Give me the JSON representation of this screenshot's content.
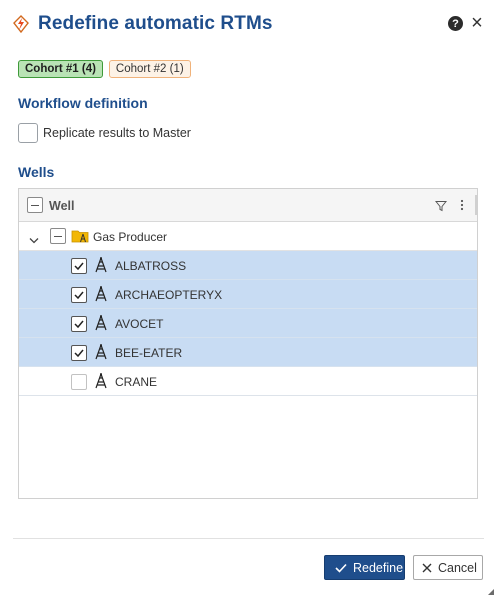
{
  "dialog": {
    "title": "Redefine automatic RTMs",
    "help_icon": "question-circle-icon",
    "close_icon": "close-icon",
    "help_glyph": "?",
    "close_glyph": "×"
  },
  "cohorts": [
    {
      "label": "Cohort #1 (4)",
      "active": true,
      "color": "#3f9a3a"
    },
    {
      "label": "Cohort #2 (1)",
      "active": false,
      "color": "#f0b27a"
    }
  ],
  "workflow": {
    "section_title": "Workflow definition",
    "replicate_label": "Replicate results to Master",
    "replicate_checked": false
  },
  "wells": {
    "section_title": "Wells",
    "column_header": "Well",
    "group": {
      "label": "Gas Producer",
      "expanded": true,
      "state": "indeterminate"
    },
    "items": [
      {
        "name": "ALBATROSS",
        "checked": true
      },
      {
        "name": "ARCHAEOPTERYX",
        "checked": true
      },
      {
        "name": "AVOCET",
        "checked": true
      },
      {
        "name": "BEE-EATER",
        "checked": true
      },
      {
        "name": "CRANE",
        "checked": false
      }
    ]
  },
  "footer": {
    "primary_label": "Redefine",
    "secondary_label": "Cancel"
  },
  "colors": {
    "accent": "#1f4e8c",
    "selected_row": "#c8dcf3",
    "cohort_active_bg": "#b9e3b5",
    "cohort_inactive_bg": "#fdf2e6"
  }
}
